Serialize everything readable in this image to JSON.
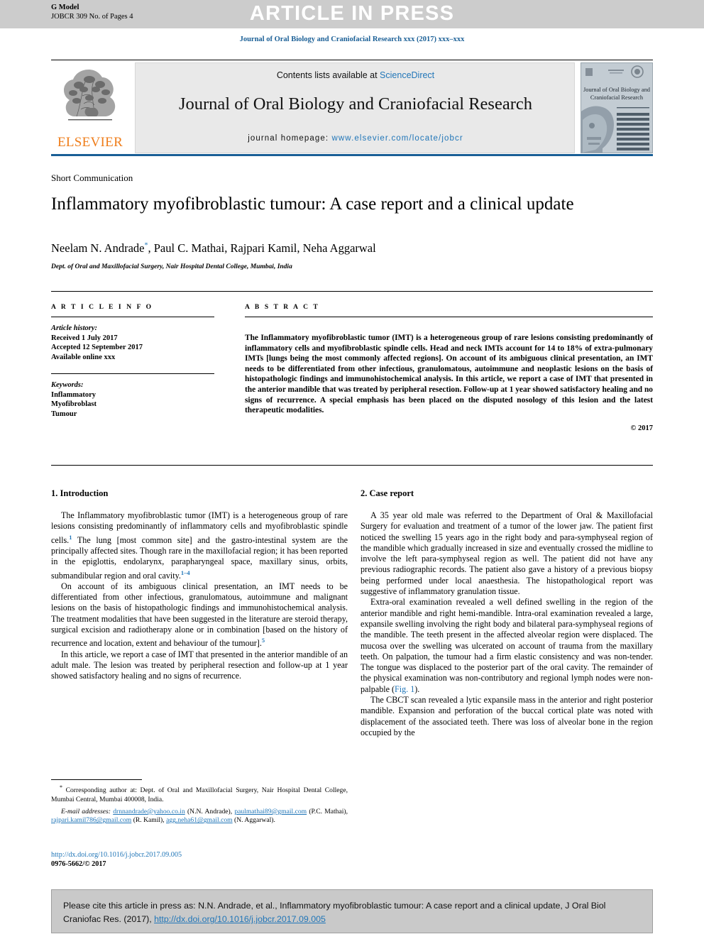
{
  "banner": {
    "g_model": "G Model",
    "journal_code": "JOBCR 309 No. of Pages 4",
    "article_in_press": "ARTICLE IN PRESS"
  },
  "journal_line": "Journal of Oral Biology and Craniofacial Research xxx (2017) xxx–xxx",
  "masthead": {
    "contents_prefix": "Contents lists available at ",
    "contents_link": "ScienceDirect",
    "journal_title": "Journal of Oral Biology and Craniofacial Research",
    "homepage_label": "journal homepage: ",
    "homepage_url": "www.elsevier.com/locate/jobcr",
    "publisher": "ELSEVIER",
    "cover_title_line1": "Journal of Oral Biology and",
    "cover_title_line2": "Craniofacial Research"
  },
  "article": {
    "section_type": "Short Communication",
    "title": "Inflammatory myofibroblastic tumour: A case report and a clinical update",
    "authors": "Neelam N. Andrade*, Paul C. Mathai, Rajpari Kamil, Neha Aggarwal",
    "authors_before_star": "Neelam N. Andrade",
    "authors_after_star": ", Paul C. Mathai, Rajpari Kamil, Neha Aggarwal",
    "corresponding_marker": "*",
    "affiliation": "Dept. of Oral and Maxillofacial Surgery, Nair Hospital Dental College, Mumbai, India"
  },
  "article_info": {
    "label": "A R T I C L E   I N F O",
    "history_label": "Article history:",
    "received": "Received 1 July 2017",
    "accepted": "Accepted 12 September 2017",
    "available": "Available online xxx",
    "keywords_label": "Keywords:",
    "keywords": [
      "Inflammatory",
      "Myofibroblast",
      "Tumour"
    ]
  },
  "abstract": {
    "label": "A B S T R A C T",
    "text": "The Inflammatory myofibroblastic tumor (IMT) is a heterogeneous group of rare lesions consisting predominantly of inflammatory cells and myofibroblastic spindle cells. Head and neck IMTs account for 14 to 18% of extra-pulmonary IMTs [lungs being the most commonly affected regions]. On account of its ambiguous clinical presentation, an IMT needs to be differentiated from other infectious, granulomatous, autoimmune and neoplastic lesions on the basis of histopathologic findings and immunohistochemical analysis. In this article, we report a case of IMT that presented in the anterior mandible that was treated by peripheral resection. Follow-up at 1 year showed satisfactory healing and no signs of recurrence. A special emphasis has been placed on the disputed nosology of this lesion and the latest therapeutic modalities.",
    "copyright": "© 2017"
  },
  "introduction": {
    "heading": "1. Introduction",
    "p1_a": "The Inflammatory myofibroblastic tumor (IMT) is a heterogeneous group of rare lesions consisting predominantly of inflammatory cells and myofibroblastic spindle cells.",
    "p1_ref1": "1",
    "p1_b": " The lung [most common site] and the gastro-intestinal system are the principally affected sites. Though rare in the maxillofacial region; it has been reported in the epiglottis, endolarynx, parapharyngeal space, maxillary sinus, orbits, submandibular region and oral cavity.",
    "p1_ref2": "1–4",
    "p2_a": "On account of its ambiguous clinical presentation, an IMT needs to be differentiated from other infectious, granulomatous, autoimmune and malignant lesions on the basis of histopathologic findings and immunohistochemical analysis. The treatment modalities that have been suggested in the literature are steroid therapy, surgical excision and radiotherapy alone or in combination [based on the history of recurrence and location, extent and behaviour of the tumour].",
    "p2_ref": "5",
    "p3": "In this article, we report a case of IMT that presented in the anterior mandible of an adult male. The lesion was treated by peripheral resection and follow-up at 1 year showed satisfactory healing and no signs of recurrence."
  },
  "case_report": {
    "heading": "2. Case report",
    "p1": "A 35 year old male was referred to the Department of Oral & Maxillofacial Surgery for evaluation and treatment of a tumor of the lower jaw. The patient first noticed the swelling 15 years ago in the right body and para-symphyseal region of the mandible which gradually increased in size and eventually crossed the midline to involve the left para-symphyseal region as well. The patient did not have any previous radiographic records. The patient also gave a history of a previous biopsy being performed under local anaesthesia. The histopathological report was suggestive of inflammatory granulation tissue.",
    "p2_a": "Extra-oral examination revealed a well defined swelling in the region of the anterior mandible and right hemi-mandible. Intra-oral examination revealed a large, expansile swelling involving the right body and bilateral para-symphyseal regions of the mandible. The teeth present in the affected alveolar region were displaced. The mucosa over the swelling was ulcerated on account of trauma from the maxillary teeth. On palpation, the tumour had a firm elastic consistency and was non-tender. The tongue was displaced to the posterior part of the oral cavity. The remainder of the physical examination was non-contributory and regional lymph nodes were non-palpable (",
    "p2_figlink": "Fig. 1",
    "p2_b": ").",
    "p3": "The CBCT scan revealed a lytic expansile mass in the anterior and right posterior mandible. Expansion and perforation of the buccal cortical plate was noted with displacement of the associated teeth. There was loss of alveolar bone in the region occupied by the"
  },
  "footnote": {
    "star": "*",
    "corresponding": "Corresponding author at: Dept. of Oral and Maxillofacial Surgery, Nair Hospital Dental College, Mumbai Central, Mumbai 400008, India.",
    "email_label": "E-mail addresses:",
    "emails": [
      {
        "address": "drnnandrade@yahoo.co.in",
        "owner": "(N.N. Andrade)"
      },
      {
        "address": "paulmathai89@gmail.com",
        "owner": "(P.C. Mathai)"
      },
      {
        "address": "rajpari.kamil786@gmail.com",
        "owner": "(R. Kamil)"
      },
      {
        "address": "agg.neha61@gmail.com",
        "owner": "(N. Aggarwal)"
      }
    ],
    "doi_url": "http://dx.doi.org/10.1016/j.jobcr.2017.09.005",
    "issn_line": "0976-5662/© 2017"
  },
  "cite_footer": {
    "text_a": "Please cite this article in press as: N.N. Andrade, et al., Inflammatory myofibroblastic tumour: A case report and a clinical update, J Oral Biol Craniofac Res. (2017), ",
    "doi": "http://dx.doi.org/10.1016/j.jobcr.2017.09.005"
  },
  "colors": {
    "link_blue": "#2176b8",
    "header_blue": "#1a5f96",
    "elsevier_orange": "#ef7d1a",
    "banner_gray": "#cccccc",
    "masthead_gray": "#e9e9e9",
    "cite_gray": "#c9c9c9"
  }
}
